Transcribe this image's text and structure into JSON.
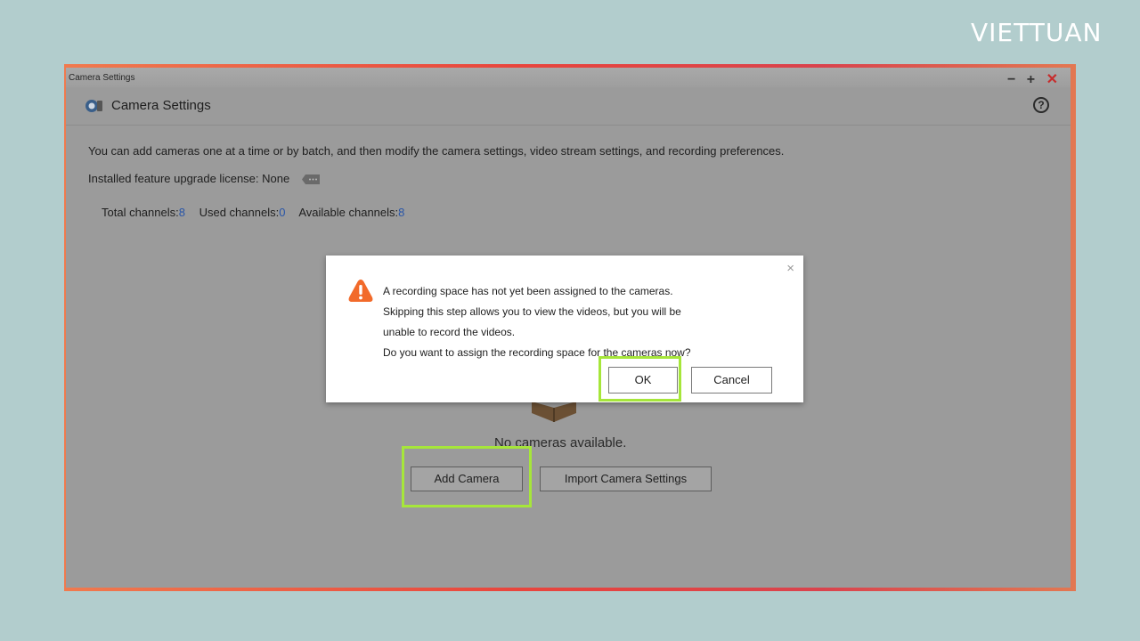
{
  "brand": {
    "logo_text": "VIETTUAN"
  },
  "window": {
    "titlebar_text": "Camera Settings",
    "controls": {
      "minimize": "−",
      "maximize": "+",
      "close": "✕"
    },
    "header_title": "Camera Settings",
    "help_icon": "?"
  },
  "main": {
    "intro": "You can add cameras one at a time or by batch, and then modify the camera settings, video stream settings, and recording preferences.",
    "license_label": "Installed feature upgrade license: None",
    "channels": {
      "total_label": "Total channels:",
      "total_value": "8",
      "used_label": "Used channels:",
      "used_value": "0",
      "available_label": "Available channels:",
      "available_value": "8"
    },
    "empty_text": "No cameras available.",
    "add_camera_label": "Add Camera",
    "import_label": "Import Camera Settings"
  },
  "dialog": {
    "close_glyph": "×",
    "lines": [
      "A recording space has not yet been assigned to the cameras.",
      "Skipping this step allows you to view the videos, but you will be",
      "unable to record the videos.",
      "Do you want to assign the recording space for the cameras now?"
    ],
    "ok_label": "OK",
    "cancel_label": "Cancel"
  },
  "colors": {
    "background": "#b2cdcd",
    "highlight": "#a6e63a",
    "warning": "#f26a2a",
    "channel_value": "#2855a8"
  }
}
